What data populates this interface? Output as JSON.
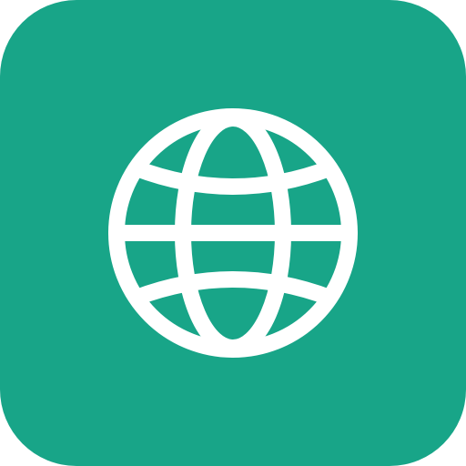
{
  "app_icon": {
    "icon": "globe-icon",
    "background_color": "#18a588",
    "glyph_color": "#ffffff"
  }
}
